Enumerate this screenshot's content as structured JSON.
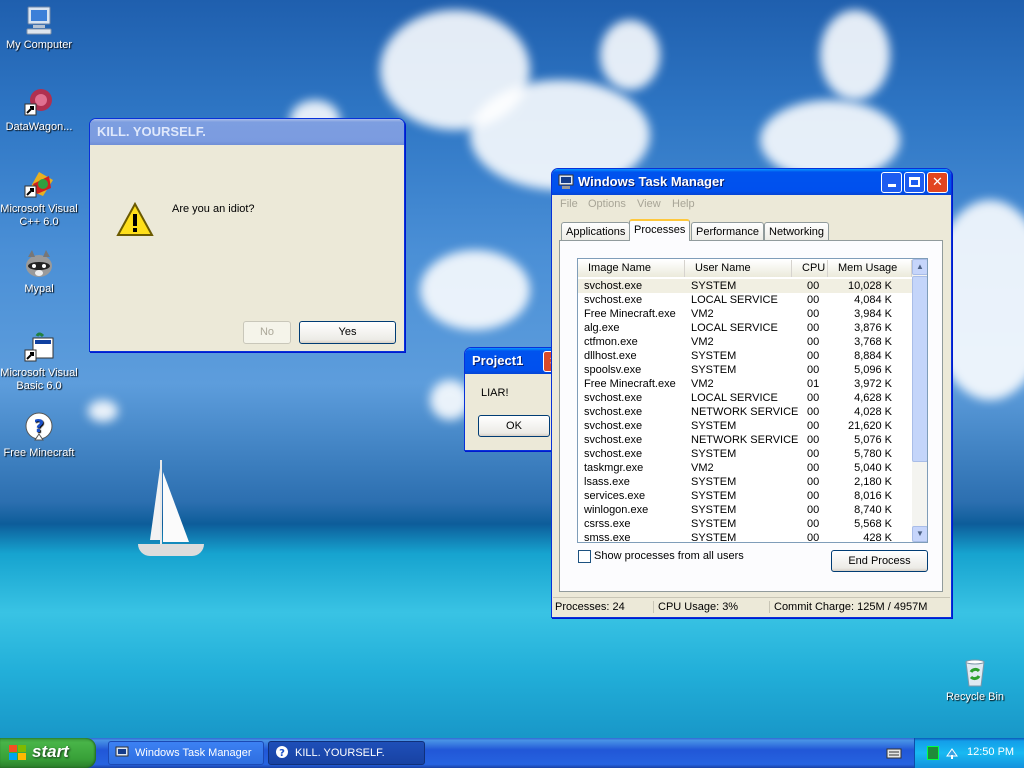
{
  "desktop_icons": [
    {
      "label": "My Computer"
    },
    {
      "label": "DataWagon..."
    },
    {
      "label": "Microsoft Visual C++ 6.0"
    },
    {
      "label": "Mypal"
    },
    {
      "label": "Microsoft Visual Basic 6.0"
    },
    {
      "label": "Free Minecraft"
    },
    {
      "label": "Recycle Bin"
    }
  ],
  "kill_dialog": {
    "title": "KILL. YOURSELF.",
    "message": "Are you an idiot?",
    "no_label": "No",
    "yes_label": "Yes"
  },
  "project_dialog": {
    "title": "Project1",
    "message": "LIAR!",
    "ok_label": "OK"
  },
  "task_manager": {
    "title": "Windows Task Manager",
    "menu": [
      "File",
      "Options",
      "View",
      "Help"
    ],
    "tabs": [
      "Applications",
      "Processes",
      "Performance",
      "Networking"
    ],
    "columns": [
      "Image Name",
      "User Name",
      "CPU",
      "Mem Usage"
    ],
    "rows": [
      [
        "svchost.exe",
        "SYSTEM",
        "00",
        "10,028 K"
      ],
      [
        "svchost.exe",
        "LOCAL SERVICE",
        "00",
        "4,084 K"
      ],
      [
        "Free Minecraft.exe",
        "VM2",
        "00",
        "3,984 K"
      ],
      [
        "alg.exe",
        "LOCAL SERVICE",
        "00",
        "3,876 K"
      ],
      [
        "ctfmon.exe",
        "VM2",
        "00",
        "3,768 K"
      ],
      [
        "dllhost.exe",
        "SYSTEM",
        "00",
        "8,884 K"
      ],
      [
        "spoolsv.exe",
        "SYSTEM",
        "00",
        "5,096 K"
      ],
      [
        "Free Minecraft.exe",
        "VM2",
        "01",
        "3,972 K"
      ],
      [
        "svchost.exe",
        "LOCAL SERVICE",
        "00",
        "4,628 K"
      ],
      [
        "svchost.exe",
        "NETWORK SERVICE",
        "00",
        "4,028 K"
      ],
      [
        "svchost.exe",
        "SYSTEM",
        "00",
        "21,620 K"
      ],
      [
        "svchost.exe",
        "NETWORK SERVICE",
        "00",
        "5,076 K"
      ],
      [
        "svchost.exe",
        "SYSTEM",
        "00",
        "5,780 K"
      ],
      [
        "taskmgr.exe",
        "VM2",
        "00",
        "5,040 K"
      ],
      [
        "lsass.exe",
        "SYSTEM",
        "00",
        "2,180 K"
      ],
      [
        "services.exe",
        "SYSTEM",
        "00",
        "8,016 K"
      ],
      [
        "winlogon.exe",
        "SYSTEM",
        "00",
        "8,740 K"
      ],
      [
        "csrss.exe",
        "SYSTEM",
        "00",
        "5,568 K"
      ],
      [
        "smss.exe",
        "SYSTEM",
        "00",
        "428 K"
      ]
    ],
    "show_all_label": "Show processes from all users",
    "end_process_label": "End Process",
    "status": {
      "processes": "Processes: 24",
      "cpu": "CPU Usage: 3%",
      "commit": "Commit Charge: 125M / 4957M"
    }
  },
  "taskbar": {
    "start_label": "start",
    "items": [
      {
        "label": "Windows Task Manager"
      },
      {
        "label": "KILL. YOURSELF."
      }
    ],
    "clock": "12:50 PM"
  }
}
